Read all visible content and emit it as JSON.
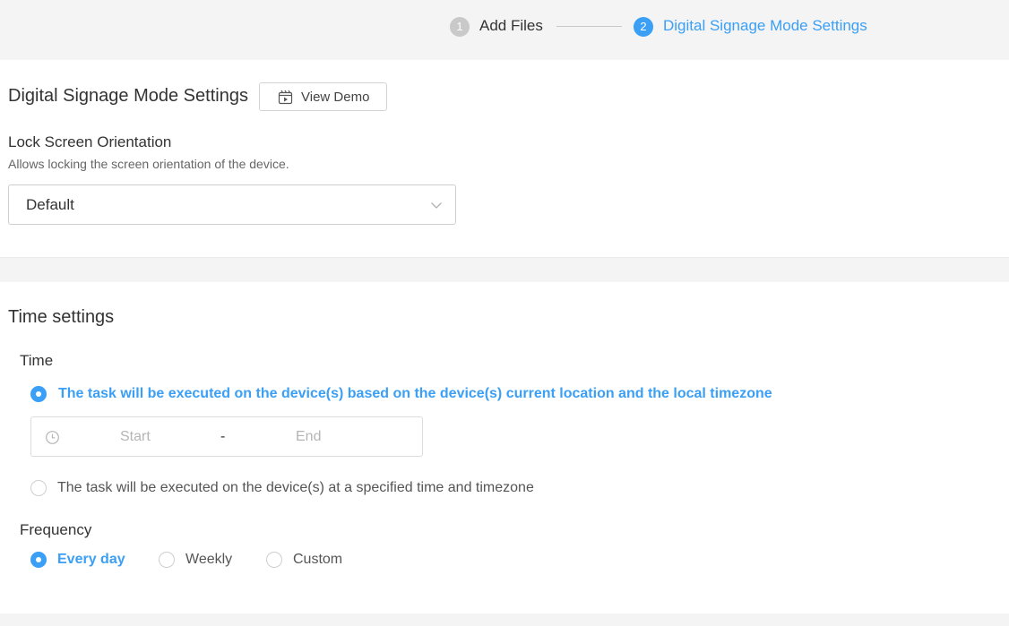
{
  "steps": [
    {
      "number": "1",
      "label": "Add Files",
      "state": "inactive"
    },
    {
      "number": "2",
      "label": "Digital Signage Mode Settings",
      "state": "active"
    }
  ],
  "colors": {
    "accent": "#3a9ff5",
    "inactive_step": "#c9c9c9",
    "background": "#f4f4f4"
  },
  "signage": {
    "title": "Digital Signage Mode Settings",
    "demo_button": {
      "label": "View Demo",
      "icon": "video-icon"
    },
    "orientation": {
      "label": "Lock Screen Orientation",
      "description": "Allows locking the screen orientation of the device.",
      "value": "Default"
    }
  },
  "time_settings": {
    "title": "Time settings",
    "time": {
      "label": "Time",
      "options": [
        {
          "label": "The task will be executed on the device(s) based on the device(s) current location and the local timezone",
          "selected": true
        },
        {
          "label": "The task will be executed on the device(s) at a specified time and timezone",
          "selected": false
        }
      ],
      "range": {
        "start_placeholder": "Start",
        "separator": "-",
        "end_placeholder": "End",
        "icon": "clock-icon"
      }
    },
    "frequency": {
      "label": "Frequency",
      "options": [
        {
          "label": "Every day",
          "selected": true
        },
        {
          "label": "Weekly",
          "selected": false
        },
        {
          "label": "Custom",
          "selected": false
        }
      ]
    }
  }
}
